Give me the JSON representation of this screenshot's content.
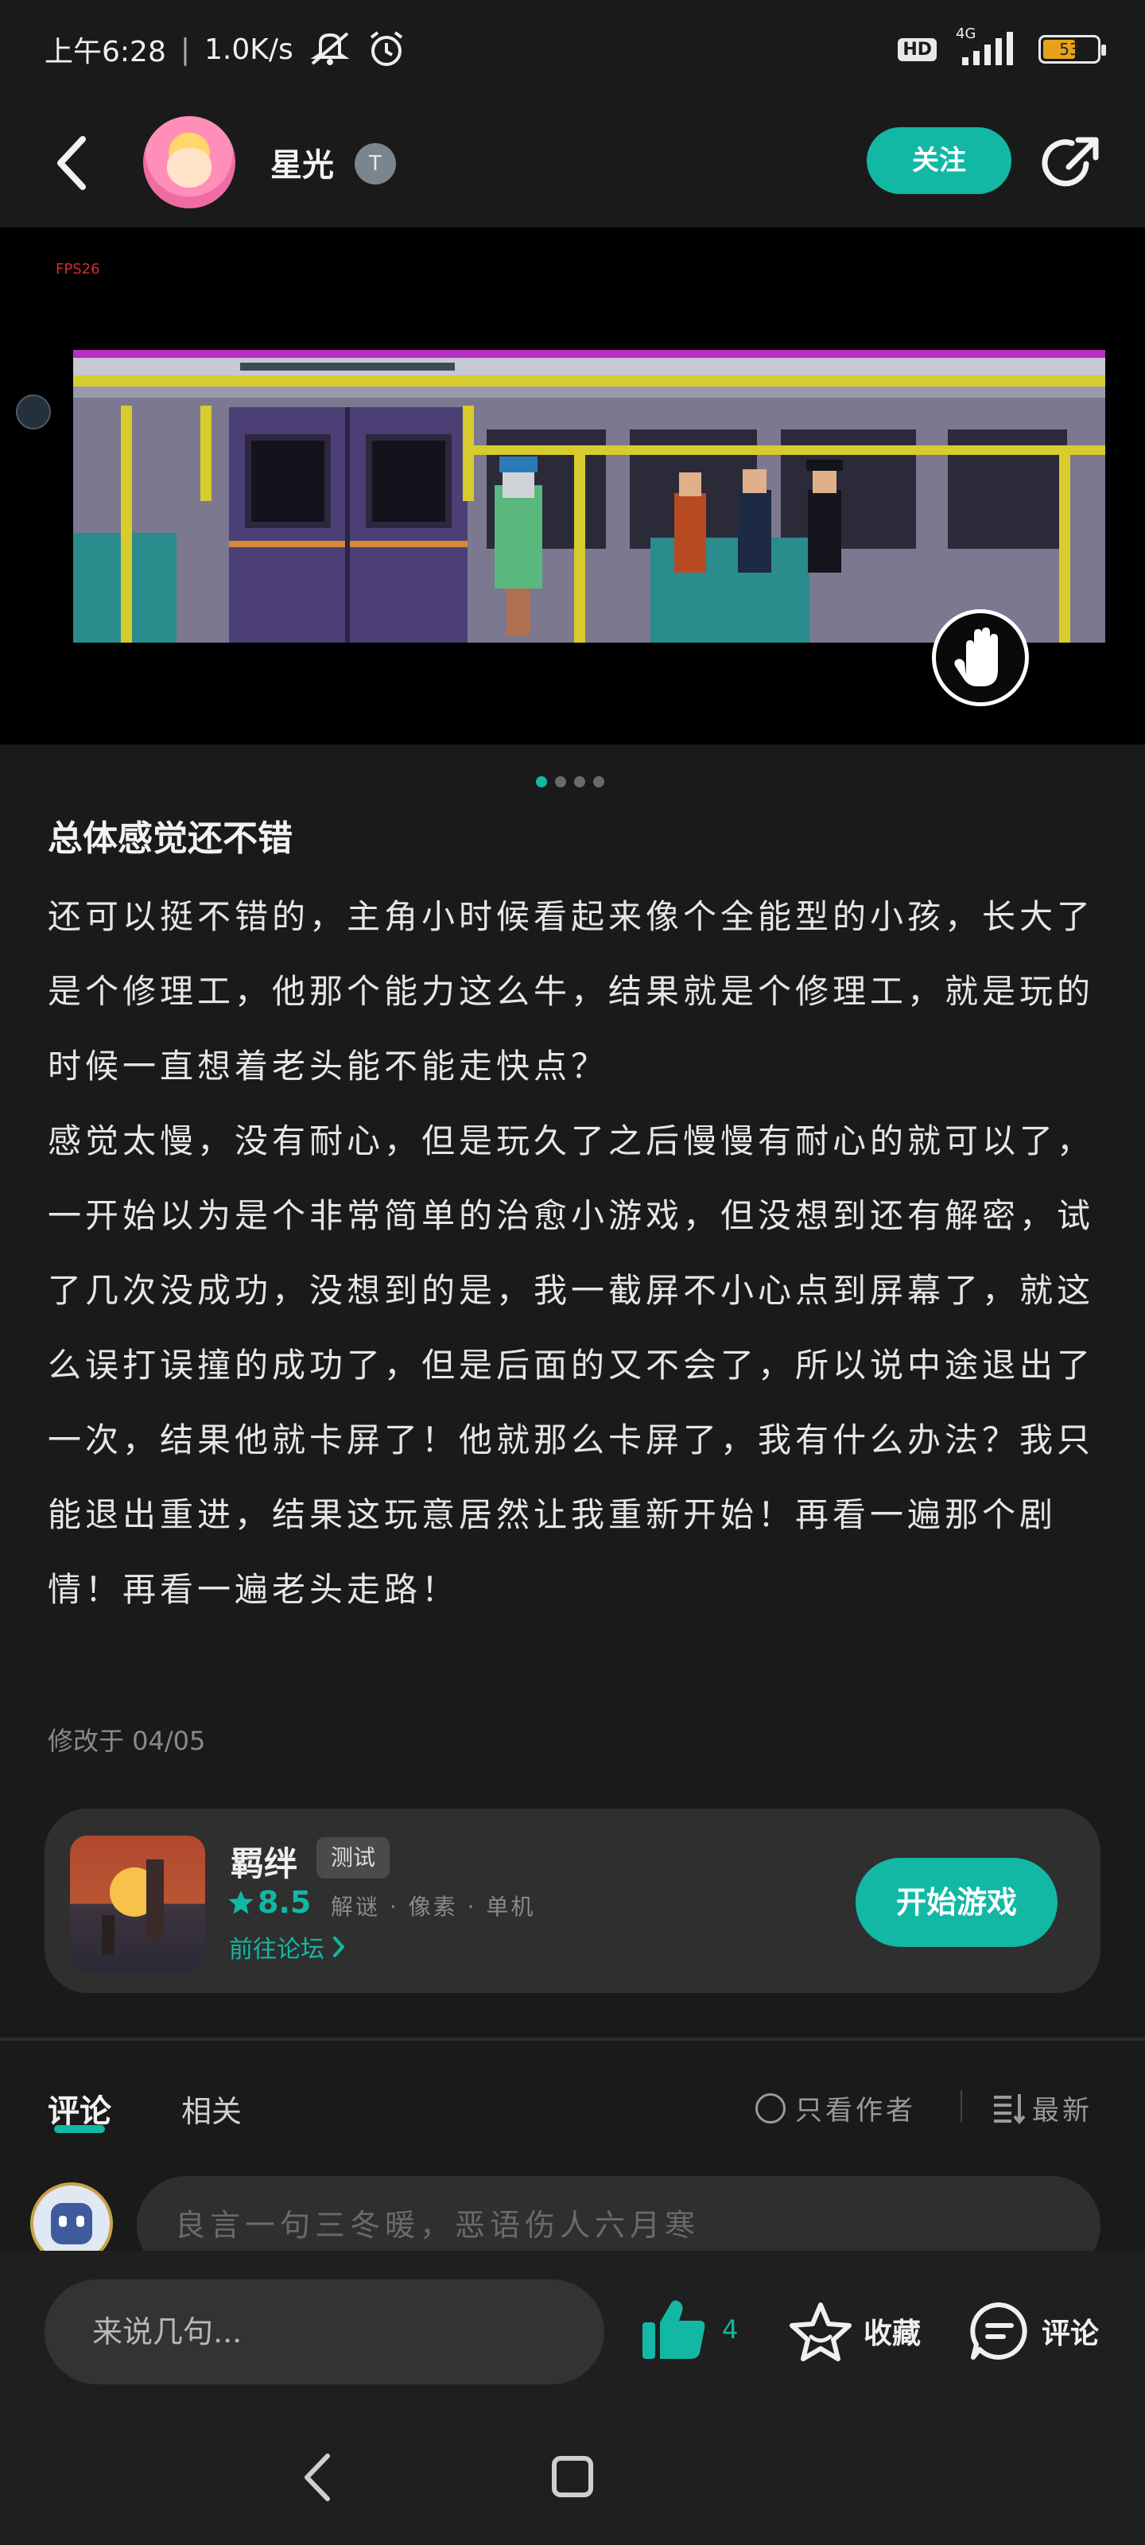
{
  "status_bar": {
    "time": "上午6:28",
    "speed": "1.0K/s",
    "hd": "HD",
    "network": "4G",
    "battery": "53"
  },
  "header": {
    "username": "星光",
    "level_badge": "T",
    "follow_label": "关注"
  },
  "media": {
    "fps_label": "FPS26",
    "page_count": 4,
    "active_page": 1
  },
  "post": {
    "title": "总体感觉还不错",
    "paragraphs": [
      "还可以挺不错的，主角小时候看起来像个全能型的小孩，长大了是个修理工，他那个能力这么牛，结果就是个修理工，就是玩的时候一直想着老头能不能走快点？",
      "感觉太慢，没有耐心，但是玩久了之后慢慢有耐心的就可以了，一开始以为是个非常简单的治愈小游戏，但没想到还有解密，试了几次没成功，没想到的是，我一截屏不小心点到屏幕了，就这么误打误撞的成功了，但是后面的又不会了，所以说中途退出了一次，结果他就卡屏了！他就那么卡屏了，我有什么办法？我只能退出重进，结果这玩意居然让我重新开始！再看一遍那个剧情！再看一遍老头走路！"
    ],
    "modified": "修改于 04/05"
  },
  "game_card": {
    "name": "羁绊",
    "badge": "测试",
    "rating": "8.5",
    "tags": "解谜 · 像素 · 单机",
    "forum_link": "前往论坛",
    "start_label": "开始游戏"
  },
  "tabs": {
    "comments": "评论",
    "related": "相关",
    "author_only": "只看作者",
    "sort": "最新"
  },
  "comment_box": {
    "placeholder": "良言一句三冬暖，恶语伤人六月寒"
  },
  "bottom_bar": {
    "input_placeholder": "来说几句...",
    "like_count": "4",
    "favorite_label": "收藏",
    "comment_label": "评论"
  },
  "colors": {
    "accent": "#12b8a4",
    "background": "#1a1a1a",
    "card": "#2f2f2f"
  }
}
